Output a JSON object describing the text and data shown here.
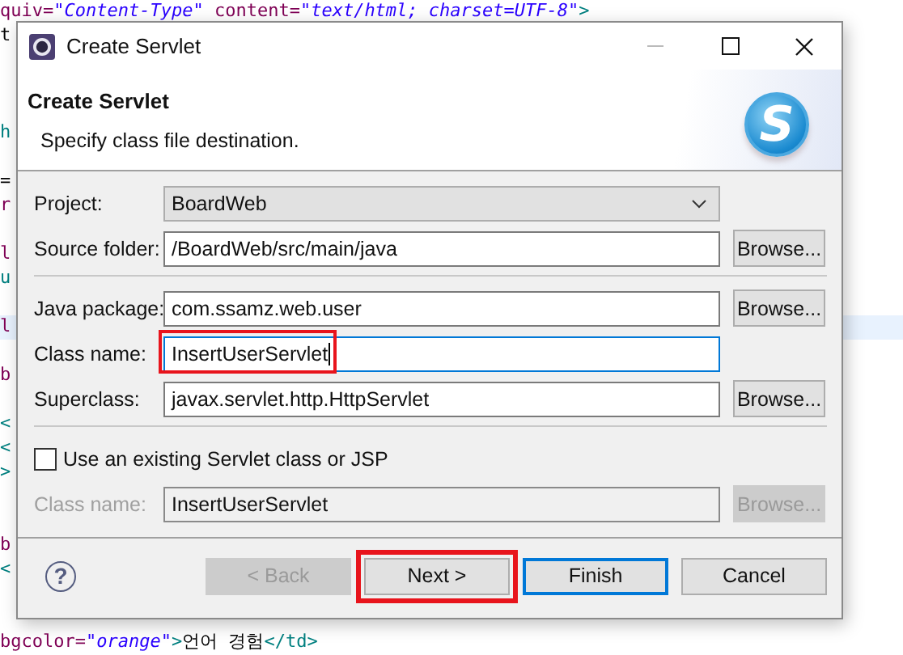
{
  "editor": {
    "lines": [
      {
        "kind": "code",
        "segments": [
          {
            "kind": "attr",
            "text": "quiv="
          },
          {
            "kind": "string",
            "text": "\"Content-Type\""
          },
          {
            "kind": "attr",
            "text": " content="
          },
          {
            "kind": "string",
            "text": "\"text/html; charset=UTF-8\""
          },
          {
            "kind": "tag",
            "text": ">"
          }
        ]
      },
      {
        "kind": "code",
        "segments": [
          {
            "kind": "text",
            "text": "t"
          }
        ]
      },
      {
        "kind": "blank"
      },
      {
        "kind": "blank"
      },
      {
        "kind": "blank"
      },
      {
        "kind": "code",
        "segments": [
          {
            "kind": "tag",
            "text": "h"
          }
        ]
      },
      {
        "kind": "blank"
      },
      {
        "kind": "code",
        "segments": [
          {
            "kind": "text",
            "text": "="
          }
        ]
      },
      {
        "kind": "code",
        "segments": [
          {
            "kind": "attr",
            "text": "r"
          }
        ]
      },
      {
        "kind": "blank"
      },
      {
        "kind": "code",
        "segments": [
          {
            "kind": "attr",
            "text": "l"
          }
        ]
      },
      {
        "kind": "code",
        "segments": [
          {
            "kind": "tag",
            "text": "u"
          }
        ]
      },
      {
        "kind": "blank"
      },
      {
        "kind": "code",
        "current": true,
        "segments": [
          {
            "kind": "attr",
            "text": "l"
          }
        ]
      },
      {
        "kind": "blank"
      },
      {
        "kind": "code",
        "segments": [
          {
            "kind": "attr",
            "text": "b"
          }
        ]
      },
      {
        "kind": "blank"
      },
      {
        "kind": "code",
        "segments": [
          {
            "kind": "tag",
            "text": "<"
          }
        ]
      },
      {
        "kind": "code",
        "segments": [
          {
            "kind": "tag",
            "text": "<"
          }
        ]
      },
      {
        "kind": "code",
        "segments": [
          {
            "kind": "tag",
            "text": ">"
          }
        ]
      },
      {
        "kind": "blank"
      },
      {
        "kind": "blank"
      },
      {
        "kind": "code",
        "segments": [
          {
            "kind": "attr",
            "text": "b"
          }
        ]
      },
      {
        "kind": "code",
        "segments": [
          {
            "kind": "tag",
            "text": "<"
          }
        ]
      },
      {
        "kind": "blank"
      },
      {
        "kind": "blank"
      },
      {
        "kind": "code",
        "segments": [
          {
            "kind": "attr",
            "text": "bgcolor="
          },
          {
            "kind": "string",
            "text": "\"orange\""
          },
          {
            "kind": "tag",
            "text": ">"
          },
          {
            "kind": "text",
            "text": "언어 경험"
          },
          {
            "kind": "tag",
            "text": "</td>"
          }
        ]
      }
    ]
  },
  "dialog": {
    "title": "Create Servlet",
    "header": {
      "title": "Create Servlet",
      "subtitle": "Specify class file destination.",
      "logo": "S"
    },
    "sections": [
      [
        {
          "kind": "combo",
          "label": "Project:",
          "value": "BoardWeb"
        },
        {
          "kind": "field",
          "label": "Source folder:",
          "value": "/BoardWeb/src/main/java",
          "button": "Browse...",
          "disabled": false,
          "focused": false,
          "highlighted": false
        }
      ],
      [
        {
          "kind": "field",
          "label": "Java package:",
          "value": "com.ssamz.web.user",
          "button": "Browse...",
          "disabled": false,
          "focused": false,
          "highlighted": false
        },
        {
          "kind": "field",
          "label": "Class name:",
          "value": "InsertUserServlet",
          "disabled": false,
          "focused": true,
          "highlighted": true
        },
        {
          "kind": "field",
          "label": "Superclass:",
          "value": "javax.servlet.http.HttpServlet",
          "button": "Browse...",
          "disabled": false,
          "focused": false,
          "highlighted": false
        }
      ],
      [
        {
          "kind": "checkbox",
          "label": "Use an existing Servlet class or JSP",
          "checked": false
        },
        {
          "kind": "field",
          "label": "Class name:",
          "value": "InsertUserServlet",
          "button": "Browse...",
          "disabled": true,
          "focused": false,
          "highlighted": false
        }
      ]
    ],
    "help": "?",
    "buttons": [
      {
        "label": "< Back",
        "disabled": true,
        "highlighted": false,
        "default": false
      },
      {
        "label": "Next >",
        "disabled": false,
        "highlighted": true,
        "default": false
      },
      {
        "label": "Finish",
        "disabled": false,
        "highlighted": false,
        "default": true
      },
      {
        "label": "Cancel",
        "disabled": false,
        "highlighted": false,
        "default": false
      }
    ]
  }
}
